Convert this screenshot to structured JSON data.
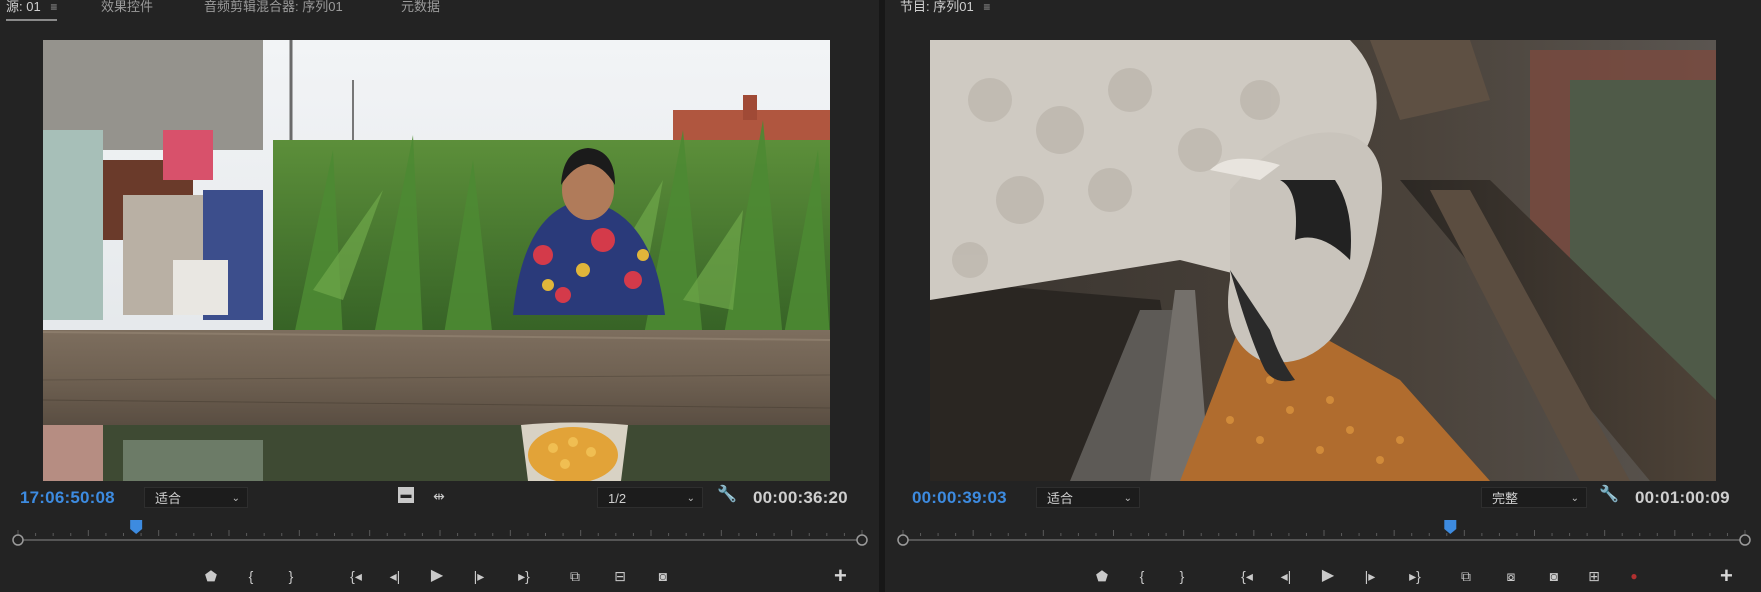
{
  "source": {
    "tabs": [
      {
        "label": "源: 01",
        "active": true
      },
      {
        "label": "效果控件",
        "active": false
      },
      {
        "label": "音频剪辑混合器: 序列01",
        "active": false
      },
      {
        "label": "元数据",
        "active": false
      }
    ],
    "current_timecode": "17:06:50:08",
    "zoom_select": "适合",
    "resolution_select": "1/2",
    "duration_timecode": "00:00:36:20",
    "playhead_fraction": 0.14,
    "icons": [
      "settings-square-icon",
      "insert-marker-icon",
      "wrench-icon"
    ],
    "transport": [
      "add-marker-icon",
      "mark-in-icon",
      "mark-out-icon",
      "go-to-in-icon",
      "step-back-icon",
      "play-icon",
      "step-forward-icon",
      "go-to-out-icon",
      "insert-icon",
      "overwrite-icon",
      "export-frame-icon"
    ]
  },
  "program": {
    "tabs": [
      {
        "label": "节目: 序列01",
        "active": true
      }
    ],
    "current_timecode": "00:00:39:03",
    "zoom_select": "适合",
    "quality_select": "完整",
    "duration_timecode": "00:01:00:09",
    "playhead_fraction": 0.65,
    "icons": [
      "wrench-icon"
    ],
    "transport": [
      "add-marker-icon",
      "mark-in-icon",
      "mark-out-icon",
      "go-to-in-icon",
      "step-back-icon",
      "play-icon",
      "step-forward-icon",
      "go-to-out-icon",
      "lift-icon",
      "extract-icon",
      "export-frame-icon",
      "compare-view-icon",
      "record-icon"
    ]
  },
  "colors": {
    "panel_bg": "#232323",
    "timecode_blue": "#3d8be0",
    "playhead_blue": "#3d8be0",
    "record_red": "#b03030"
  }
}
